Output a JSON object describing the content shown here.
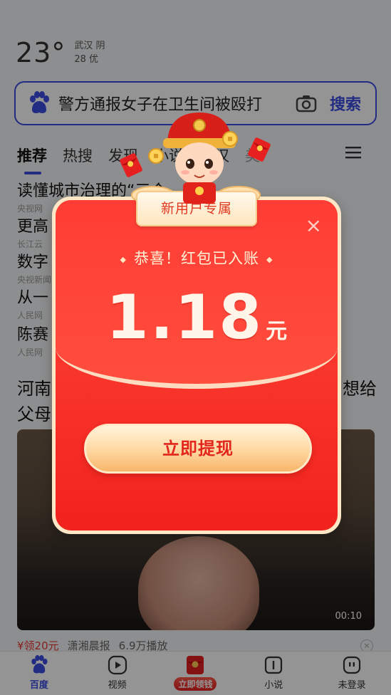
{
  "weather": {
    "temp": "23°",
    "city_cond": "武汉 阴",
    "aqi": "28 优"
  },
  "search": {
    "query": "警方通报女子在卫生间被殴打",
    "button": "搜索"
  },
  "tabs": [
    "推荐",
    "热搜",
    "发现",
    "小说",
    "武汉",
    "美"
  ],
  "news": [
    {
      "title": "读懂城市治理的“三个",
      "source": "央视网"
    },
    {
      "title": "更高",
      "source": "长江云"
    },
    {
      "title": "数字",
      "source": "央视新闻"
    },
    {
      "title": "从一",
      "source": "人民网"
    },
    {
      "title": "陈赛",
      "source": "人民网"
    }
  ],
  "feed": {
    "headline_left": "河南",
    "headline_right": "想给",
    "headline_line2": "父母",
    "duration": "00:10",
    "reward": "¥领20元",
    "source": "潇湘晨报",
    "plays": "6.9万播放"
  },
  "bottom_nav": [
    {
      "label": "百度",
      "icon": "baidu-paw-icon"
    },
    {
      "label": "视频",
      "icon": "play-icon"
    },
    {
      "label": "立即领钱",
      "icon": "red-envelope-icon"
    },
    {
      "label": "小说",
      "icon": "book-icon"
    },
    {
      "label": "未登录",
      "icon": "user-face-icon"
    }
  ],
  "modal": {
    "ribbon": "新用户专属",
    "congrats": "恭喜！红包已入账",
    "amount": "1.18",
    "unit": "元",
    "withdraw_button": "立即提现",
    "close": "×"
  },
  "colors": {
    "brand_blue": "#3b4ce0",
    "packet_red": "#f2221e",
    "gold": "#f7b56a"
  }
}
